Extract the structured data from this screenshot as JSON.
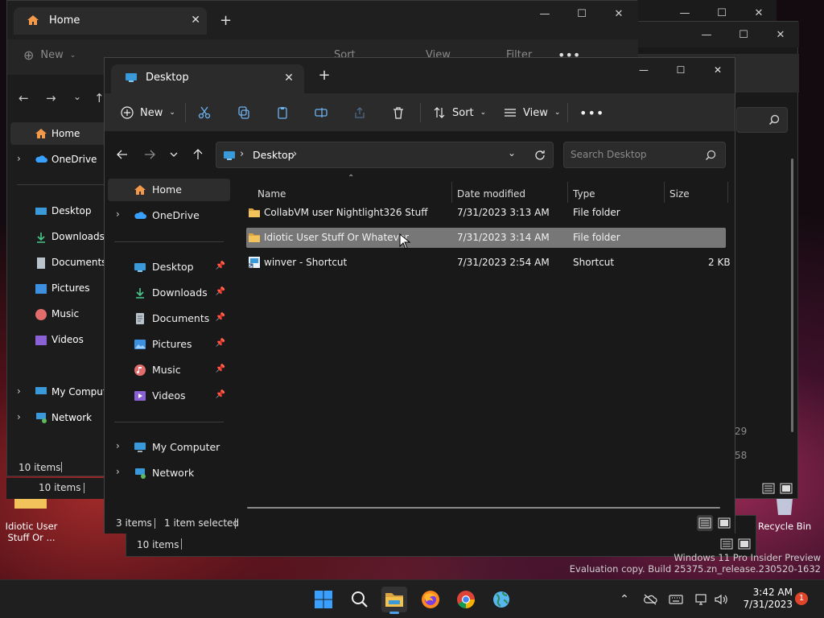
{
  "watermark": {
    "line1": "Windows 11 Pro Insider Preview",
    "line2": "Evaluation copy. Build 25375.zn_release.230520-1632"
  },
  "desktop": {
    "folder_label": "Idiotic User\nStuff Or ...",
    "recycle_bin": "Recycle Bin"
  },
  "back_window_a": {
    "tab_title": "Home",
    "new_label": "New",
    "sort_label": "Sort",
    "view_label": "View",
    "filter_label": "Filter",
    "nav": [
      "Home",
      "OneDrive",
      "Desktop",
      "Downloads",
      "Documents",
      "Pictures",
      "Music",
      "Videos",
      "My Computer",
      "Network"
    ],
    "status": "10 items"
  },
  "back_window_b": {
    "status": "10 items",
    "status2": "10 items"
  },
  "window": {
    "tab_title": "Desktop",
    "toolbar": {
      "new_label": "New",
      "sort_label": "Sort",
      "view_label": "View"
    },
    "address": {
      "location": "Desktop",
      "search_placeholder": "Search Desktop"
    },
    "nav": {
      "home": "Home",
      "onedrive": "OneDrive",
      "pinned": [
        {
          "label": "Desktop",
          "icon": "desktop-icon"
        },
        {
          "label": "Downloads",
          "icon": "downloads-icon"
        },
        {
          "label": "Documents",
          "icon": "documents-icon"
        },
        {
          "label": "Pictures",
          "icon": "pictures-icon"
        },
        {
          "label": "Music",
          "icon": "music-icon"
        },
        {
          "label": "Videos",
          "icon": "videos-icon"
        }
      ],
      "my_computer": "My Computer",
      "network": "Network"
    },
    "columns": {
      "name": "Name",
      "date": "Date modified",
      "type": "Type",
      "size": "Size"
    },
    "files": [
      {
        "name": "CollabVM user Nightlight326 Stuff",
        "date": "7/31/2023 3:13 AM",
        "type": "File folder",
        "size": "",
        "selected": false
      },
      {
        "name": "Idiotic User Stuff Or Whatever",
        "date": "7/31/2023 3:14 AM",
        "type": "File folder",
        "size": "",
        "selected": true
      },
      {
        "name": "winver - Shortcut",
        "date": "7/31/2023 2:54 AM",
        "type": "Shortcut",
        "size": "2 KB",
        "selected": false
      }
    ],
    "status": {
      "count": "3 items",
      "selected": "1 item selected"
    }
  },
  "taskbar": {
    "time": "3:42 AM",
    "date": "7/31/2023",
    "notification_count": "1"
  },
  "colors": {
    "folder": "#e8b34b",
    "accent": "#4ea0e6",
    "selection": "#777777"
  }
}
